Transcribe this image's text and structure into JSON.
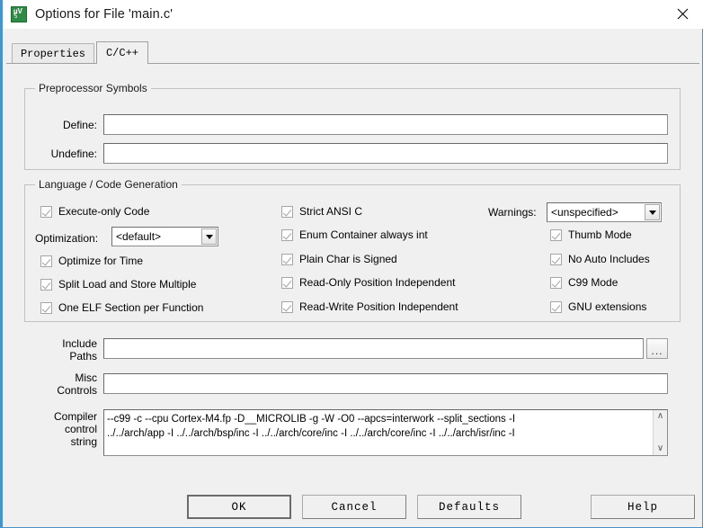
{
  "window": {
    "title": "Options for File 'main.c'",
    "app_icon": "keil-uvision-icon",
    "icon_glyph_top": "µV",
    "icon_glyph_bottom": "5",
    "close_label": "✕"
  },
  "tabs": [
    {
      "label": "Properties",
      "active": false
    },
    {
      "label": "C/C++",
      "active": true
    }
  ],
  "preprocessor": {
    "group_title": "Preprocessor Symbols",
    "define_label": "Define:",
    "define_value": "",
    "undefine_label": "Undefine:",
    "undefine_value": ""
  },
  "language": {
    "group_title": "Language / Code Generation",
    "optimization_label": "Optimization:",
    "optimization_value": "<default>",
    "warnings_label": "Warnings:",
    "warnings_value": "<unspecified>",
    "column_left": [
      {
        "label": "Execute-only Code",
        "checked": true
      },
      {
        "label": "Optimize for Time",
        "checked": true
      },
      {
        "label": "Split Load and Store Multiple",
        "checked": true
      },
      {
        "label": "One ELF Section per Function",
        "checked": true
      }
    ],
    "column_middle": [
      {
        "label": "Strict ANSI C",
        "checked": true
      },
      {
        "label": "Enum Container always int",
        "checked": true
      },
      {
        "label": "Plain Char is Signed",
        "checked": true
      },
      {
        "label": "Read-Only Position Independent",
        "checked": true
      },
      {
        "label": "Read-Write Position Independent",
        "checked": true
      }
    ],
    "column_right": [
      {
        "label": "Thumb Mode",
        "checked": true
      },
      {
        "label": "No Auto Includes",
        "checked": true
      },
      {
        "label": "C99 Mode",
        "checked": true
      },
      {
        "label": "GNU extensions",
        "checked": true
      }
    ]
  },
  "paths": {
    "include_label_line1": "Include",
    "include_label_line2": "Paths",
    "include_value": "",
    "browse_label": "...",
    "misc_label_line1": "Misc",
    "misc_label_line2": "Controls",
    "misc_value": ""
  },
  "compiler": {
    "label_line1": "Compiler",
    "label_line2": "control",
    "label_line3": "string",
    "line1": "--c99 -c --cpu Cortex-M4.fp -D__MICROLIB -g -W -O0 --apcs=interwork --split_sections -I",
    "line2": "../../arch/app -I ../../arch/bsp/inc -I ../../arch/core/inc -I ../../arch/core/inc -I ../../arch/isr/inc -I",
    "scroll_up_icon": "∧",
    "scroll_down_icon": "∨"
  },
  "buttons": {
    "ok": "OK",
    "cancel": "Cancel",
    "defaults": "Defaults",
    "help": "Help"
  }
}
